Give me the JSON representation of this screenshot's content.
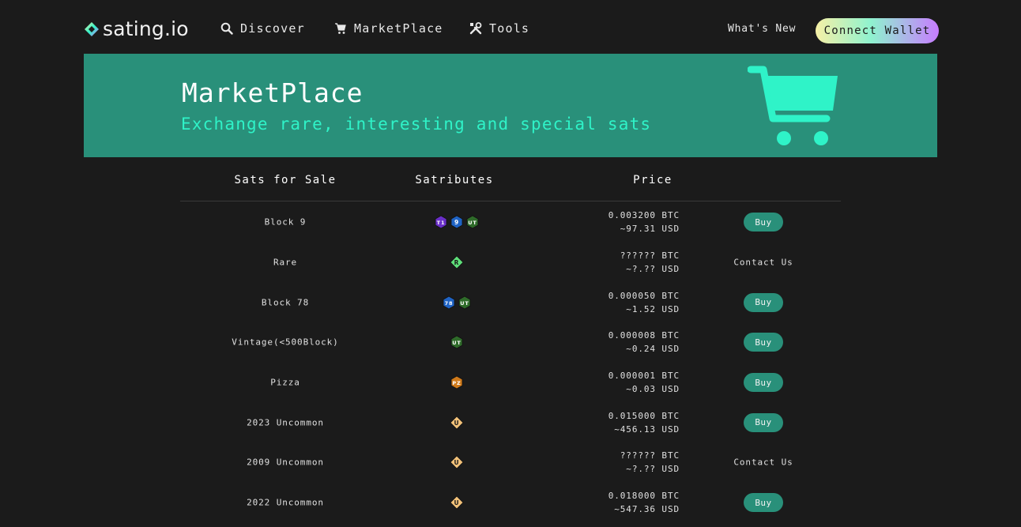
{
  "nav": {
    "logo": "sating.io",
    "links": [
      {
        "label": "Discover",
        "icon": "search-icon"
      },
      {
        "label": "MarketPlace",
        "icon": "cart-icon"
      },
      {
        "label": "Tools",
        "icon": "tools-icon"
      }
    ],
    "whats_new": "What's New",
    "connect": "Connect Wallet"
  },
  "hero": {
    "title": "MarketPlace",
    "subtitle": "Exchange rare, interesting and special sats",
    "icon": "shopping-cart-icon",
    "accent": "#2ff3c8",
    "background": "#29907a"
  },
  "table": {
    "headers": [
      "Sats for Sale",
      "Satributes",
      "Price"
    ],
    "rows": [
      {
        "name": "Block 9",
        "badges": [
          {
            "t": "T1",
            "c": "#6a2fc8"
          },
          {
            "t": "9",
            "c": "#1f63c4"
          },
          {
            "t": "UT",
            "c": "#2f6b2a"
          }
        ],
        "btc": "0.003200 BTC",
        "usd": "~97.31 USD",
        "action": "Buy"
      },
      {
        "name": "Rare",
        "badges": [
          {
            "t": "R",
            "c": "#5fe07a"
          }
        ],
        "btc": "?????? BTC",
        "usd": "~?.?? USD",
        "action": "Contact Us"
      },
      {
        "name": "Block 78",
        "badges": [
          {
            "t": "78",
            "c": "#1f63c4"
          },
          {
            "t": "UT",
            "c": "#2f6b2a"
          }
        ],
        "btc": "0.000050 BTC",
        "usd": "~1.52 USD",
        "action": "Buy"
      },
      {
        "name": "Vintage(<500Block)",
        "badges": [
          {
            "t": "UT",
            "c": "#2f6b2a"
          }
        ],
        "btc": "0.000008 BTC",
        "usd": "~0.24 USD",
        "action": "Buy"
      },
      {
        "name": "Pizza",
        "badges": [
          {
            "t": "PZ",
            "c": "#d07a1a"
          }
        ],
        "btc": "0.000001 BTC",
        "usd": "~0.03 USD",
        "action": "Buy"
      },
      {
        "name": "2023 Uncommon",
        "badges": [
          {
            "t": "U",
            "c": "#f3c27a"
          }
        ],
        "btc": "0.015000 BTC",
        "usd": "~456.13 USD",
        "action": "Buy"
      },
      {
        "name": "2009 Uncommon",
        "badges": [
          {
            "t": "U",
            "c": "#f3c27a"
          }
        ],
        "btc": "?????? BTC",
        "usd": "~?.?? USD",
        "action": "Contact Us"
      },
      {
        "name": "2022 Uncommon",
        "badges": [
          {
            "t": "U",
            "c": "#f3c27a"
          }
        ],
        "btc": "0.018000 BTC",
        "usd": "~547.36 USD",
        "action": "Buy"
      }
    ]
  }
}
